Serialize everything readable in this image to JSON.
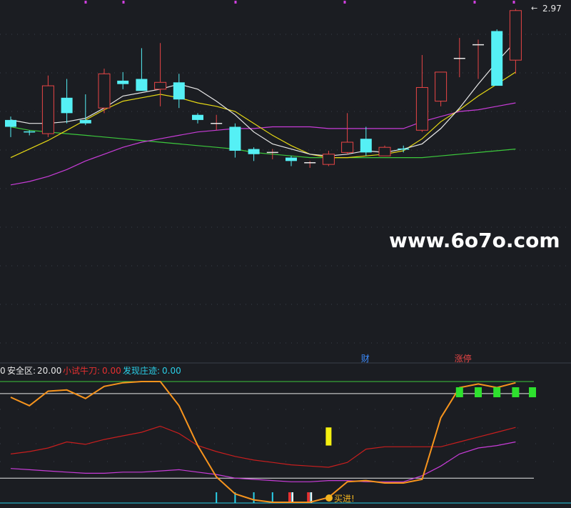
{
  "colors": {
    "background": "#1b1d22",
    "grid": "#3a3f4a",
    "up": "#e84545",
    "down": "#55f0f5",
    "ma_white": "#e8e8e8",
    "ma_yellow": "#e6d814",
    "ma_magenta": "#c83cd8",
    "ma_green": "#3cc83c",
    "osc_orange": "#f7941d",
    "osc_red": "#c81e1e",
    "osc_magenta": "#c83cd8",
    "safe_text": "#e8e8e8",
    "xiaoshi_text": "#e83030",
    "faxian_text": "#2ad0e8"
  },
  "price_panel": {
    "max_label": "2.97",
    "watermark": "www.6o7o.com",
    "tags": [
      {
        "text": "财",
        "candle_index": 19,
        "color": "#3c8cff"
      },
      {
        "text": "涨停",
        "candle_index": 24,
        "color": "#e84545"
      }
    ]
  },
  "indicator_panel": {
    "header": {
      "prefix": "0",
      "safe_label": "安全区:",
      "safe_value": "20.00",
      "xiaoshi_label": "小试牛刀:",
      "xiaoshi_value": "0.00",
      "faxian_label": "发现庄迹:",
      "faxian_value": "0.00"
    },
    "buy_label": "买进!"
  },
  "chart_data": {
    "type": "candlestick",
    "price_ylim": [
      1.35,
      2.98
    ],
    "candles": [
      {
        "o": 2.32,
        "h": 2.34,
        "l": 2.22,
        "c": 2.28
      },
      {
        "o": 2.25,
        "h": 2.26,
        "l": 2.23,
        "c": 2.24
      },
      {
        "o": 2.24,
        "h": 2.58,
        "l": 2.22,
        "c": 2.52
      },
      {
        "o": 2.45,
        "h": 2.56,
        "l": 2.3,
        "c": 2.36
      },
      {
        "o": 2.32,
        "h": 2.47,
        "l": 2.29,
        "c": 2.3
      },
      {
        "o": 2.39,
        "h": 2.62,
        "l": 2.36,
        "c": 2.59
      },
      {
        "o": 2.55,
        "h": 2.6,
        "l": 2.5,
        "c": 2.53
      },
      {
        "o": 2.56,
        "h": 2.74,
        "l": 2.5,
        "c": 2.49
      },
      {
        "o": 2.5,
        "h": 2.77,
        "l": 2.4,
        "c": 2.54
      },
      {
        "o": 2.54,
        "h": 2.59,
        "l": 2.39,
        "c": 2.44
      },
      {
        "o": 2.35,
        "h": 2.36,
        "l": 2.3,
        "c": 2.32
      },
      {
        "o": 2.3,
        "h": 2.35,
        "l": 2.26,
        "c": 2.3
      },
      {
        "o": 2.28,
        "h": 2.3,
        "l": 2.1,
        "c": 2.14
      },
      {
        "o": 2.15,
        "h": 2.16,
        "l": 2.08,
        "c": 2.12
      },
      {
        "o": 2.13,
        "h": 2.15,
        "l": 2.09,
        "c": 2.13
      },
      {
        "o": 2.1,
        "h": 2.11,
        "l": 2.05,
        "c": 2.08
      },
      {
        "o": 2.06,
        "h": 2.08,
        "l": 2.04,
        "c": 2.07
      },
      {
        "o": 2.06,
        "h": 2.14,
        "l": 2.05,
        "c": 2.12
      },
      {
        "o": 2.13,
        "h": 2.36,
        "l": 2.12,
        "c": 2.19
      },
      {
        "o": 2.21,
        "h": 2.28,
        "l": 2.11,
        "c": 2.13
      },
      {
        "o": 2.11,
        "h": 2.17,
        "l": 2.11,
        "c": 2.16
      },
      {
        "o": 2.15,
        "h": 2.17,
        "l": 2.13,
        "c": 2.14
      },
      {
        "o": 2.26,
        "h": 2.7,
        "l": 2.25,
        "c": 2.51
      },
      {
        "o": 2.43,
        "h": 2.6,
        "l": 2.4,
        "c": 2.6
      },
      {
        "o": 2.68,
        "h": 2.8,
        "l": 2.57,
        "c": 2.68
      },
      {
        "o": 2.75,
        "h": 2.79,
        "l": 2.56,
        "c": 2.76
      },
      {
        "o": 2.84,
        "h": 2.85,
        "l": 2.56,
        "c": 2.52
      },
      {
        "o": 2.67,
        "h": 2.97,
        "l": 2.59,
        "c": 2.96
      }
    ],
    "ma_white": [
      2.32,
      2.3,
      2.3,
      2.31,
      2.33,
      2.39,
      2.46,
      2.48,
      2.5,
      2.53,
      2.5,
      2.43,
      2.35,
      2.25,
      2.18,
      2.15,
      2.12,
      2.11,
      2.12,
      2.14,
      2.13,
      2.15,
      2.18,
      2.27,
      2.39,
      2.53,
      2.66,
      2.78
    ],
    "ma_yellow": [
      2.1,
      2.15,
      2.2,
      2.26,
      2.32,
      2.38,
      2.43,
      2.45,
      2.47,
      2.45,
      2.42,
      2.4,
      2.37,
      2.3,
      2.23,
      2.17,
      2.12,
      2.1,
      2.1,
      2.11,
      2.12,
      2.14,
      2.21,
      2.31,
      2.38,
      2.46,
      2.53,
      2.6
    ],
    "ma_magenta": [
      1.94,
      1.96,
      1.99,
      2.03,
      2.08,
      2.12,
      2.16,
      2.19,
      2.21,
      2.23,
      2.25,
      2.26,
      2.27,
      2.27,
      2.28,
      2.28,
      2.28,
      2.27,
      2.27,
      2.27,
      2.27,
      2.27,
      2.31,
      2.34,
      2.37,
      2.38,
      2.4,
      2.42
    ],
    "ma_green": [
      2.28,
      2.26,
      2.25,
      2.24,
      2.23,
      2.22,
      2.21,
      2.2,
      2.19,
      2.18,
      2.17,
      2.16,
      2.15,
      2.13,
      2.12,
      2.11,
      2.1,
      2.1,
      2.1,
      2.1,
      2.1,
      2.1,
      2.1,
      2.11,
      2.12,
      2.13,
      2.14,
      2.15
    ],
    "indicator_ylim": [
      0,
      100
    ],
    "osc_orange": [
      87,
      80,
      92,
      93,
      86,
      96,
      99,
      100,
      100,
      80,
      47,
      21,
      7,
      2,
      0,
      0,
      0,
      4,
      17,
      18,
      16,
      16,
      19,
      70,
      95,
      98,
      95,
      99
    ],
    "osc_red": [
      40,
      42,
      45,
      50,
      48,
      52,
      55,
      58,
      63,
      57,
      47,
      42,
      38,
      35,
      33,
      31,
      30,
      29,
      33,
      44,
      46,
      46,
      46,
      46,
      50,
      54,
      58,
      62
    ],
    "osc_magenta": [
      28,
      27,
      26,
      25,
      24,
      24,
      25,
      25,
      26,
      27,
      25,
      23,
      20,
      19,
      18,
      17,
      17,
      18,
      18,
      17,
      17,
      17,
      22,
      30,
      40,
      45,
      47,
      50
    ],
    "upper_threshold": 90,
    "lower_threshold": 20,
    "yellow_signal": {
      "candle_index": 17,
      "from": 47,
      "to": 62
    },
    "cyan_bars": [
      11,
      12,
      13,
      14,
      15,
      16
    ],
    "red_bars": [
      15,
      16
    ],
    "green_markers": [
      24,
      25,
      26,
      27,
      28
    ]
  }
}
